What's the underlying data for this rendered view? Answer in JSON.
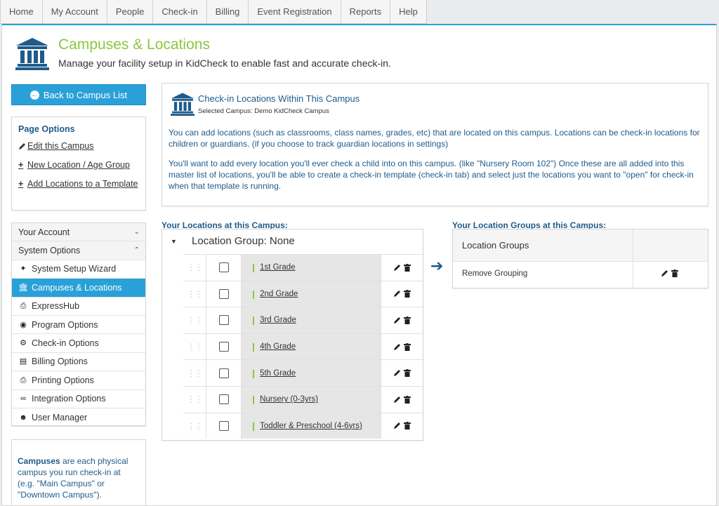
{
  "nav": {
    "tabs": [
      "Home",
      "My Account",
      "People",
      "Check-in",
      "Billing",
      "Event Registration",
      "Reports",
      "Help"
    ]
  },
  "header": {
    "title": "Campuses & Locations",
    "subtitle": "Manage your facility setup in KidCheck to enable fast and accurate check-in.",
    "icon": "building-columns-icon"
  },
  "back_button": {
    "label": "Back to Campus List"
  },
  "page_options": {
    "title": "Page Options",
    "links": [
      {
        "label": "Edit this Campus",
        "icon": "pencil-icon"
      },
      {
        "label": "New Location / Age Group",
        "icon": "plus-icon"
      },
      {
        "label": "Add Locations to a Template",
        "icon": "plus-icon"
      }
    ]
  },
  "system_menu": {
    "your_account": "Your Account",
    "system_options": "System Options",
    "items": [
      {
        "label": "System Setup Wizard",
        "icon": "wand-icon"
      },
      {
        "label": "Campuses & Locations",
        "icon": "building-columns-icon",
        "active": true
      },
      {
        "label": "ExpressHub",
        "icon": "printer-icon"
      },
      {
        "label": "Program Options",
        "icon": "mask-icon"
      },
      {
        "label": "Check-in Options",
        "icon": "gears-icon"
      },
      {
        "label": "Billing Options",
        "icon": "file-invoice-icon"
      },
      {
        "label": "Printing Options",
        "icon": "printer-icon"
      },
      {
        "label": "Integration Options",
        "icon": "link-icon"
      },
      {
        "label": "User Manager",
        "icon": "users-icon"
      }
    ]
  },
  "info_box": {
    "bold": "Campuses",
    "text": " are each physical campus you run check-in at (e.g. \"Main Campus\" or \"Downtown Campus\")."
  },
  "intro": {
    "title": "Check-in Locations Within This Campus",
    "selected": "Selected Campus: Demo KidCheck Campus",
    "p1": "You can add locations (such as classrooms, class names, grades, etc) that are located on this campus. Locations can be check-in locations for children or guardians. (if you choose to track guardian locations in settings)",
    "p2": "You'll want to add every location you'll ever check a child into on this campus. (like \"Nursery Room 102\") Once these are all added into this master list of locations, you'll be able to create a check-in template (check-in tab) and select just the locations you want to \"open\" for check-in when that template is running."
  },
  "locations": {
    "section_title": "Your Locations at this Campus:",
    "group_label": "Location Group: None",
    "rows": [
      {
        "name": "1st Grade",
        "checked": false
      },
      {
        "name": "2nd Grade",
        "checked": false
      },
      {
        "name": "3rd Grade",
        "checked": false
      },
      {
        "name": "4th Grade",
        "checked": false
      },
      {
        "name": "5th Grade",
        "checked": false
      },
      {
        "name": "Nursery (0-3yrs)",
        "checked": false
      },
      {
        "name": "Toddler & Preschool (4-6yrs)",
        "checked": false
      }
    ]
  },
  "groups": {
    "section_title": "Your Location Groups at this Campus:",
    "header": "Location Groups",
    "rows": [
      {
        "name": "Remove Grouping"
      }
    ]
  },
  "colors": {
    "accent": "#2aa0d8",
    "title_green": "#8cc63f",
    "navy": "#1f5b8a"
  }
}
